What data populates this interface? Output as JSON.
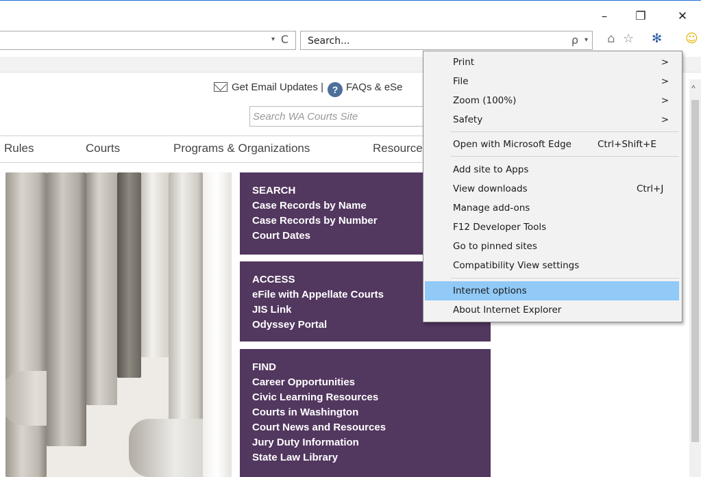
{
  "window": {
    "minimize_glyph": "–",
    "restore_glyph": "❐",
    "close_glyph": "✕"
  },
  "address_bar": {
    "dropdown_icon": "▾",
    "refresh_icon": "C"
  },
  "search_box": {
    "placeholder": "Search...",
    "search_icon": "ρ",
    "dropdown_icon": "▾"
  },
  "toolbar_icons": {
    "home": "⌂",
    "favorites": "☆",
    "tools": "✻",
    "feedback": "☺"
  },
  "page": {
    "email_updates": "Get Email Updates",
    "separator": "|",
    "faq": "FAQs & eSe",
    "site_search_placeholder": "Search WA Courts Site",
    "nav": [
      "Rules",
      "Courts",
      "Programs & Organizations",
      "Resource"
    ],
    "boxes": [
      {
        "heading": "SEARCH",
        "links": [
          "Case Records by Name",
          "Case Records by Number",
          "Court Dates"
        ]
      },
      {
        "heading": "ACCESS",
        "links": [
          "eFile with Appellate Courts",
          "JIS Link",
          "Odyssey Portal"
        ]
      },
      {
        "heading": "FIND",
        "links": [
          "Career Opportunities",
          "Civic Learning Resources",
          "Courts in Washington",
          "Court News and Resources",
          "Jury Duty Information",
          "State Law Library"
        ]
      }
    ]
  },
  "menu": {
    "items": [
      {
        "label": "Print",
        "arrow": ">"
      },
      {
        "label": "File",
        "arrow": ">"
      },
      {
        "label": "Zoom (100%)",
        "arrow": ">"
      },
      {
        "label": "Safety",
        "arrow": ">"
      },
      {
        "label": "Open with Microsoft Edge",
        "shortcut": "Ctrl+Shift+E"
      },
      {
        "label": "Add site to Apps"
      },
      {
        "label": "View downloads",
        "shortcut": "Ctrl+J"
      },
      {
        "label": "Manage add-ons"
      },
      {
        "label": "F12 Developer Tools"
      },
      {
        "label": "Go to pinned sites"
      },
      {
        "label": "Compatibility View settings"
      },
      {
        "label": "Internet options"
      },
      {
        "label": "About Internet Explorer"
      }
    ]
  },
  "colors": {
    "purple": "#52375f",
    "menu_highlight": "#91c9f7",
    "menu_bg": "#f2f2f2"
  }
}
